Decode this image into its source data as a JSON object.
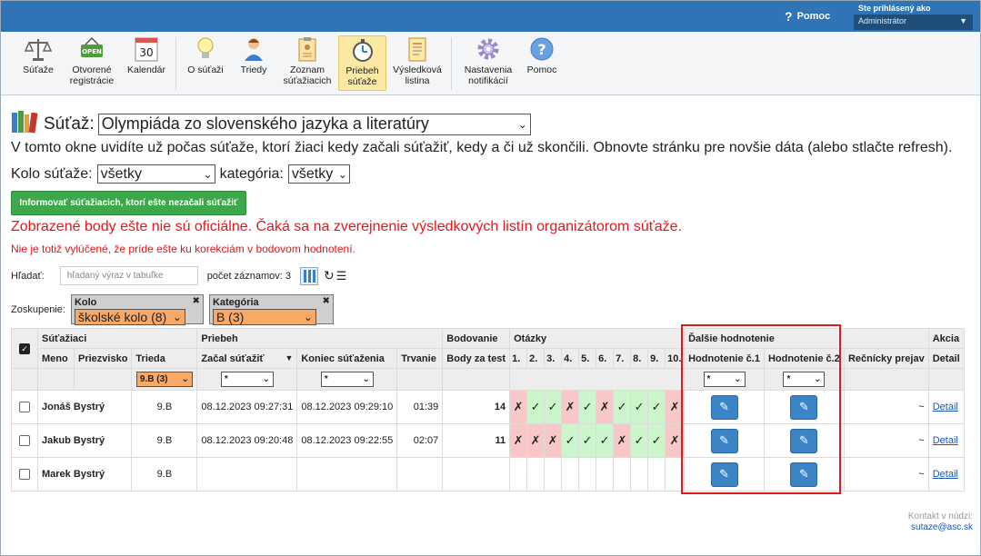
{
  "topbar": {
    "help_label": "Pomoc",
    "login_label": "Ste prihlásený ako",
    "login_role": "Administrátor"
  },
  "toolbar": {
    "items": [
      {
        "label": "Súťaže",
        "icon": "scales-icon"
      },
      {
        "label": "Otvorené registrácie",
        "icon": "open-sign-icon",
        "sign": "OPEN"
      },
      {
        "label": "Kalendár",
        "icon": "calendar-icon",
        "day": "30"
      },
      {
        "label": "O súťaži",
        "icon": "lightbulb-icon"
      },
      {
        "label": "Triedy",
        "icon": "person-icon"
      },
      {
        "label": "Zoznam súťažiacich",
        "icon": "clipboard-icon"
      },
      {
        "label": "Priebeh súťaže",
        "icon": "stopwatch-icon",
        "active": true
      },
      {
        "label": "Výsledková listina",
        "icon": "document-icon"
      },
      {
        "label": "Nastavenia notifikácií",
        "icon": "gear-icon"
      },
      {
        "label": "Pomoc",
        "icon": "help-circle-icon"
      }
    ]
  },
  "competition": {
    "label": "Súťaž:",
    "selected": "Olympiáda zo slovenského jazyka a literatúry"
  },
  "info_text": "V tomto okne uvidíte už počas súťaže, ktorí žiaci kedy začali súťažiť, kedy a či už skončili. Obnovte stránku pre novšie dáta (alebo stlačte refresh).",
  "filters": {
    "kolo_label": "Kolo súťaže:",
    "kolo_value": "všetky",
    "kategoria_label": "kategória:",
    "kategoria_value": "všetky"
  },
  "inform_button": "Informovať súťažiacich, ktorí ešte nezačali súťažiť",
  "warning_main": "Zobrazené body ešte nie sú oficiálne. Čaká sa na zverejnenie výsledkových listín organizátorom súťaže.",
  "warning_sub": "Nie je totiž vylúčené, že príde ešte ku korekciám v bodovom hodnotení.",
  "search": {
    "label": "Hľadať:",
    "placeholder": "hľadaný výraz v tabuľke",
    "count_text": "počet záznamov: 3"
  },
  "grouping": {
    "label": "Zoskupenie:",
    "groups": [
      {
        "name": "Kolo",
        "value": "školské kolo (8)"
      },
      {
        "name": "Kategória",
        "value": "B (3)"
      }
    ]
  },
  "table": {
    "group_headers": {
      "students": "Súťažiaci",
      "progress": "Priebeh",
      "scoring": "Bodovanie",
      "questions": "Otázky",
      "other": "Ďalšie hodnotenie",
      "action": "Akcia"
    },
    "columns": {
      "name": "Meno",
      "surname": "Priezvisko",
      "class": "Trieda",
      "start": "Začal súťažiť",
      "end": "Koniec súťaženia",
      "duration": "Trvanie",
      "test_points": "Body za test",
      "questions": [
        "1.",
        "2.",
        "3.",
        "4.",
        "5.",
        "6.",
        "7.",
        "8.",
        "9.",
        "10."
      ],
      "eval1": "Hodnotenie č.1",
      "eval2": "Hodnotenie č.2",
      "speech": "Rečnícky prejav",
      "detail": "Detail"
    },
    "filters": {
      "class": "9.B (3)",
      "star": "*"
    },
    "rows": [
      {
        "name": "Jonáš Bystrý",
        "class": "9.B",
        "start": "08.12.2023 09:27:31",
        "end": "08.12.2023 09:29:10",
        "duration": "01:39",
        "points": "14",
        "answers": [
          0,
          1,
          1,
          0,
          1,
          0,
          1,
          1,
          1,
          0
        ],
        "speech": "~",
        "detail": "Detail"
      },
      {
        "name": "Jakub Bystrý",
        "class": "9.B",
        "start": "08.12.2023 09:20:48",
        "end": "08.12.2023 09:22:55",
        "duration": "02:07",
        "points": "11",
        "answers": [
          0,
          0,
          0,
          1,
          1,
          1,
          0,
          1,
          1,
          0
        ],
        "speech": "~",
        "detail": "Detail"
      },
      {
        "name": "Marek Bystrý",
        "class": "9.B",
        "start": "",
        "end": "",
        "duration": "",
        "points": "",
        "answers": null,
        "speech": "~",
        "detail": "Detail"
      }
    ]
  },
  "footer": {
    "contact_label": "Kontakt v núdzi:",
    "email": "sutaze@asc.sk"
  },
  "colors": {
    "topbar": "#2f75b5",
    "accent_green": "#3da84a",
    "warning_red": "#e0191c",
    "correct_bg": "#ccf5cc",
    "wrong_bg": "#f8c8c8",
    "edit_button": "#3b84c6",
    "group_select": "#f8a967"
  }
}
